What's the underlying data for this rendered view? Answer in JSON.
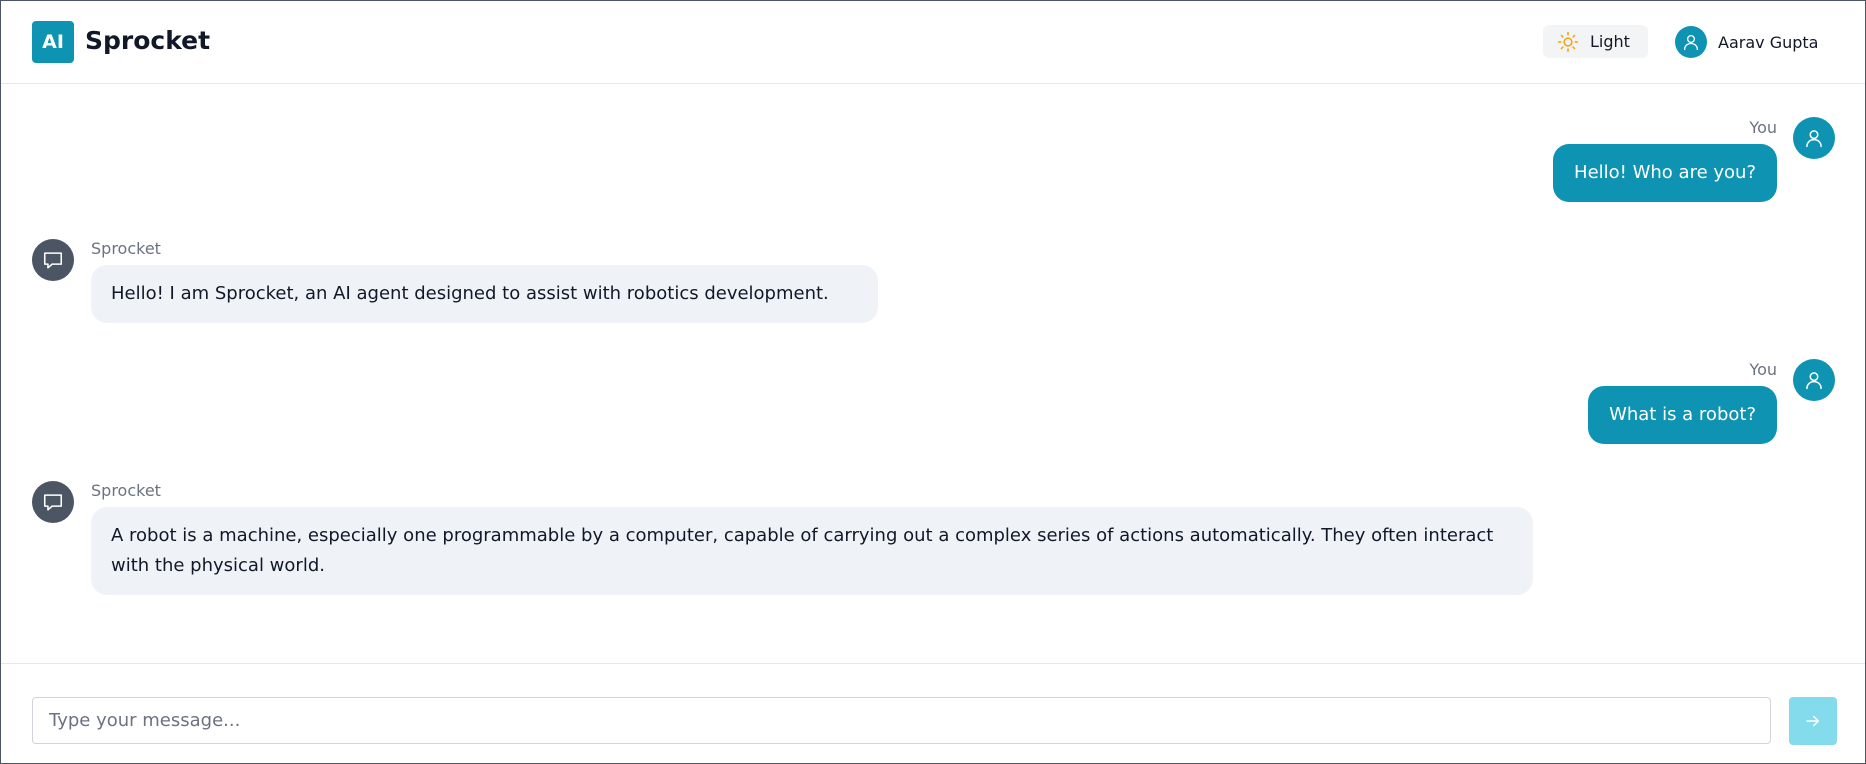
{
  "header": {
    "logo_text": "AI",
    "title": "Sprocket",
    "theme_toggle": {
      "icon": "sun-icon",
      "label": "Light"
    },
    "user": {
      "icon": "user-icon",
      "name": "Aarav Gupta"
    }
  },
  "messages": [
    {
      "role": "user",
      "sender": "You",
      "text": "Hello! Who are you?",
      "avatar_icon": "user-icon"
    },
    {
      "role": "bot",
      "sender": "Sprocket",
      "text": "Hello! I am Sprocket, an AI agent designed to assist with robotics development.",
      "avatar_icon": "chat-bubble-icon"
    },
    {
      "role": "user",
      "sender": "You",
      "text": "What is a robot?",
      "avatar_icon": "user-icon"
    },
    {
      "role": "bot",
      "sender": "Sprocket",
      "text": "A robot is a machine, especially one programmable by a computer, capable of carrying out a complex series of actions automatically. They often interact with the physical world.",
      "avatar_icon": "chat-bubble-icon"
    }
  ],
  "composer": {
    "placeholder": "Type your message...",
    "value": "",
    "send_icon": "arrow-right-icon"
  },
  "colors": {
    "accent": "#0e93b3",
    "bot_avatar": "#4b5563",
    "bot_bubble": "#eff3f8",
    "send_disabled": "#84dbec",
    "sun": "#f59e0b"
  }
}
